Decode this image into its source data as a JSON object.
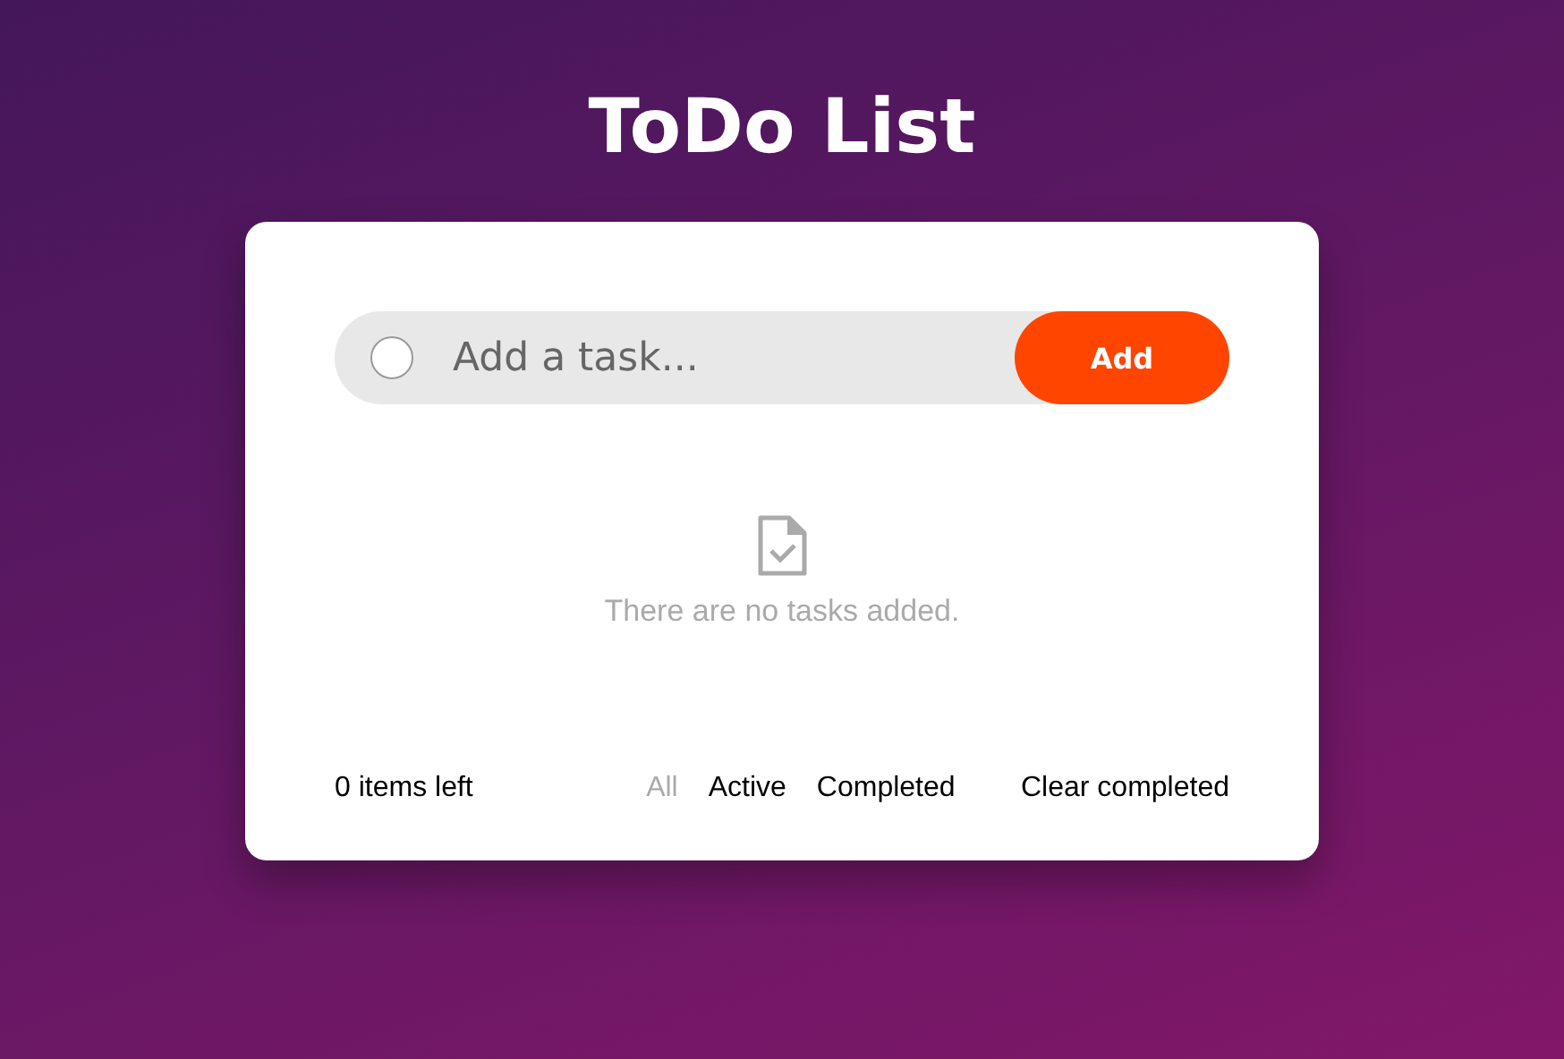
{
  "title": "ToDo List",
  "new_task": {
    "checked": false,
    "placeholder": "Add a task...",
    "button": "Add"
  },
  "empty_state": {
    "message": "There are no tasks added."
  },
  "footer": {
    "items_left": "0 items left",
    "filters": [
      {
        "label": "All",
        "selected": true
      },
      {
        "label": "Active",
        "selected": false
      },
      {
        "label": "Completed",
        "selected": false
      }
    ],
    "clear": "Clear completed"
  }
}
